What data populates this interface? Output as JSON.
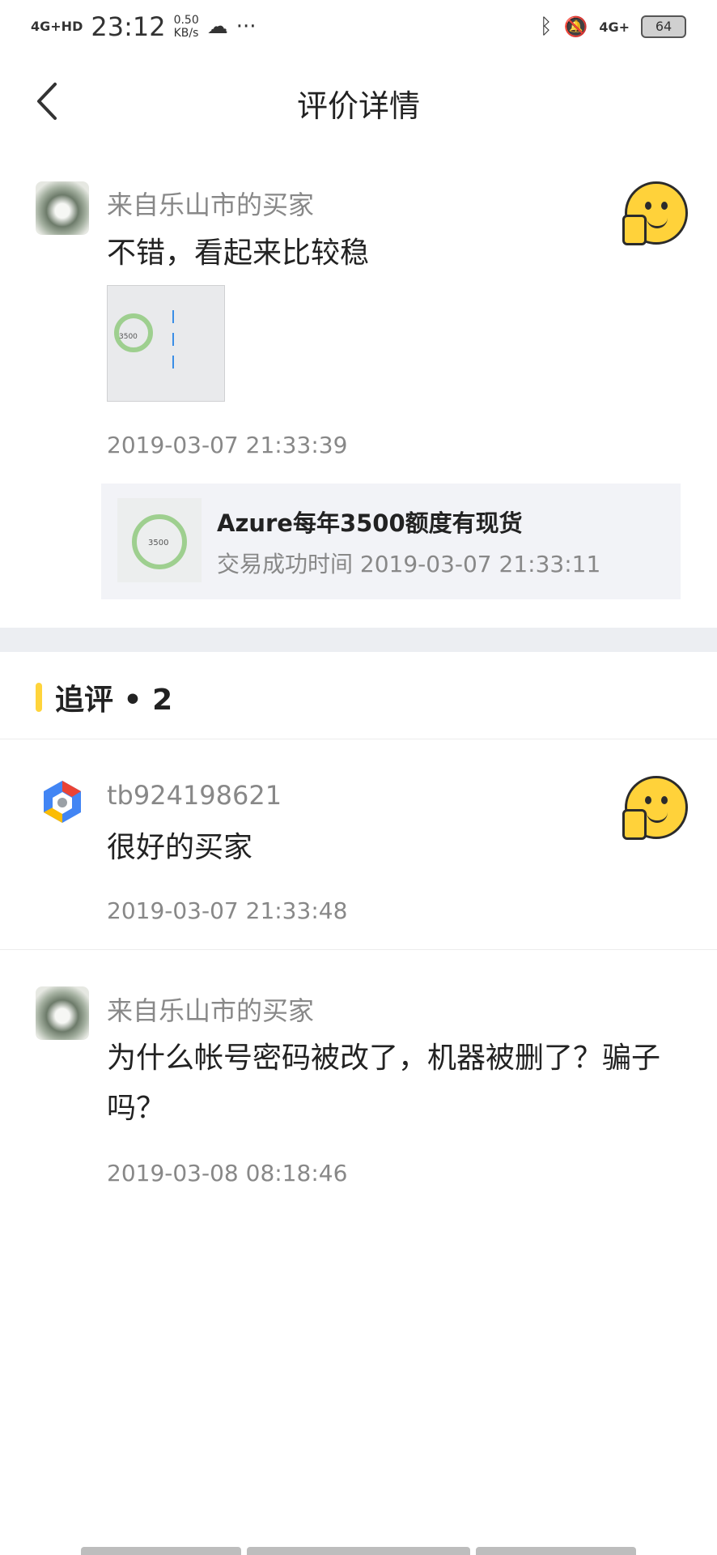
{
  "status_bar": {
    "network": "4G+HD",
    "time": "23:12",
    "speed_value": "0.50",
    "speed_unit": "KB/s",
    "network_right": "4G+",
    "battery": "64"
  },
  "header": {
    "title": "评价详情"
  },
  "review": {
    "author": "来自乐山市的买家",
    "content": "不错，看起来比较稳",
    "date": "2019-03-07 21:33:39",
    "thumbnail_text": "3500"
  },
  "product": {
    "name": "Azure每年3500额度有现货",
    "trade_time": "交易成功时间 2019-03-07 21:33:11",
    "image_text": "3500"
  },
  "followups": {
    "title": "追评 • 2",
    "items": [
      {
        "author": "tb924198621",
        "content": "很好的买家",
        "date": "2019-03-07 21:33:48"
      },
      {
        "author": "来自乐山市的买家",
        "content": "为什么帐号密码被改了，机器被删了？骗子吗？",
        "date": "2019-03-08 08:18:46"
      }
    ]
  },
  "colors": {
    "accent": "#ffd43b",
    "muted": "#888888",
    "product_bg": "#f2f3f7"
  }
}
